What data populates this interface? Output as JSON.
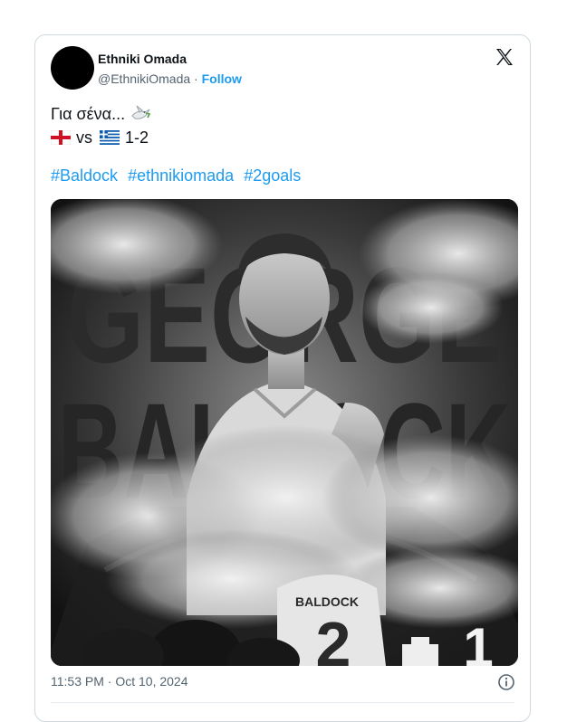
{
  "tweet": {
    "display_name": "Ethniki Omada",
    "handle": "@EthnikiOmada",
    "separator": "·",
    "follow_label": "Follow",
    "text_line1": "Για σένα...",
    "vs_text": "vs",
    "score": "1-2",
    "hashtags": [
      "#Baldock",
      "#ethnikiomada",
      "#2goals"
    ],
    "timestamp": "11:53 PM · Oct 10, 2024"
  },
  "media": {
    "title_line1": "GEORGE",
    "title_line2": "BALDOCK",
    "shirt_name": "BALDOCK",
    "shirt_number": "2",
    "corner_number": "1"
  },
  "colors": {
    "link": "#1d9bf0",
    "text": "#0f1419",
    "muted": "#536471",
    "border": "#cfd9de"
  },
  "icons": {
    "brand": "x-logo-icon",
    "info": "info-icon",
    "emoji": "dove-icon",
    "flag_left": "england-flag-icon",
    "flag_right": "greece-flag-icon"
  }
}
